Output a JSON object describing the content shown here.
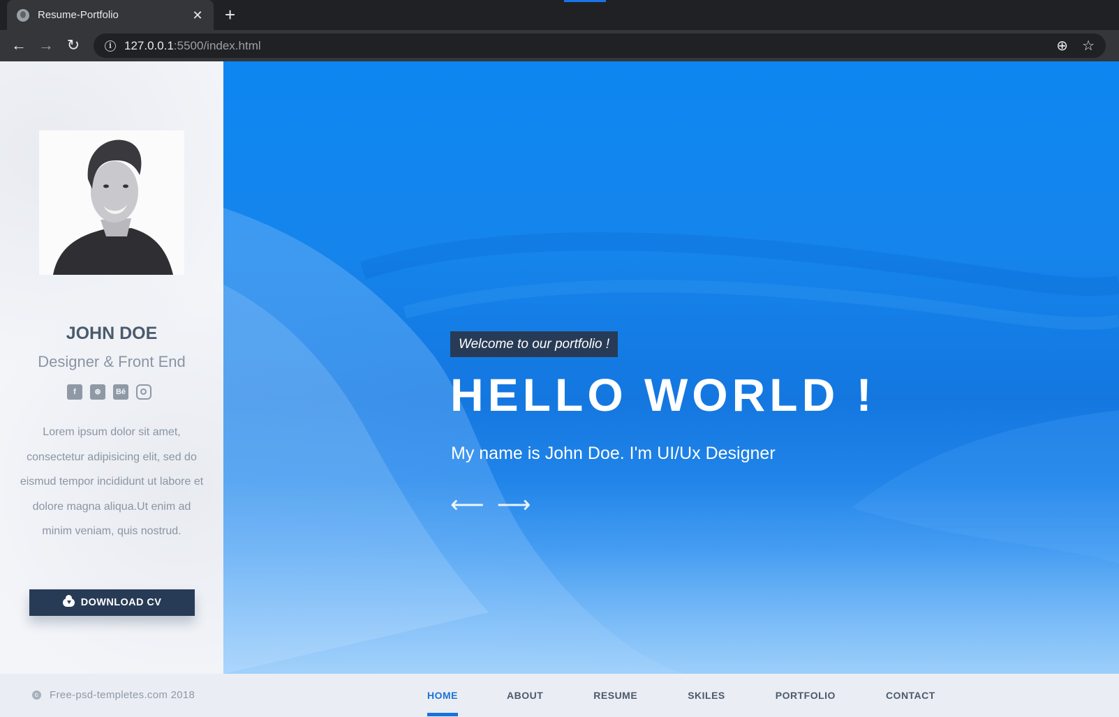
{
  "browser": {
    "tab_title": "Resume-Portfolio",
    "tab_close": "✕",
    "new_tab": "+",
    "back": "←",
    "forward": "→",
    "reload": "↻",
    "url_host": "127.0.0.1",
    "url_rest": ":5500/index.html",
    "zoom_icon": "⊕",
    "bookmark_icon": "☆"
  },
  "sidebar": {
    "name": "JOHN DOE",
    "role": "Designer & Front End",
    "socials": [
      "f",
      "⊛",
      "Bē",
      ""
    ],
    "bio": "Lorem ipsum dolor sit amet, consectetur adipisicing elit, sed do eismud tempor incididunt ut labore et dolore magna aliqua.Ut enim ad minim veniam, quis nostrud.",
    "download_label": "DOWNLOAD CV"
  },
  "hero": {
    "welcome": "Welcome to our portfolio !",
    "headline": "HELLO WORLD !",
    "subtitle": "My name is John Doe. I'm UI/Ux Designer",
    "prev_arrow": "⟵",
    "next_arrow": "⟶"
  },
  "footer": {
    "copyright_icon": "c",
    "copyright": "Free-psd-templetes.com 2018",
    "nav": [
      {
        "label": "HOME",
        "active": true
      },
      {
        "label": "ABOUT",
        "active": false
      },
      {
        "label": "RESUME",
        "active": false
      },
      {
        "label": "SKILES",
        "active": false
      },
      {
        "label": "PORTFOLIO",
        "active": false
      },
      {
        "label": "CONTACT",
        "active": false
      }
    ]
  },
  "colors": {
    "accent": "#1a72d8",
    "dark_navy": "#283b56",
    "hero_blue": "#1585ec"
  }
}
